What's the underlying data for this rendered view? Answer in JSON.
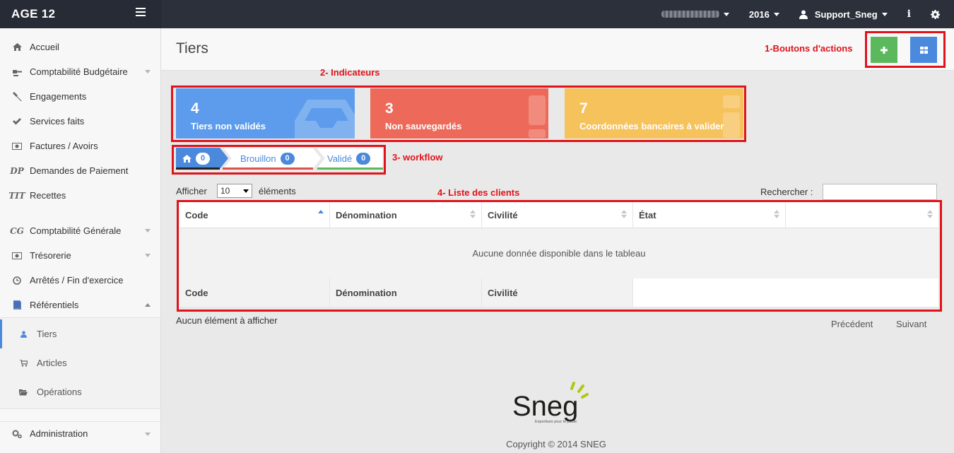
{
  "app": {
    "title": "AGE 12"
  },
  "topnav": {
    "year": "2016",
    "user": "Support_Sneg"
  },
  "sidebar": {
    "items": [
      {
        "label": "Accueil",
        "icon": "home-icon"
      },
      {
        "label": "Comptabilité Budgétaire",
        "icon": "gavel-icon",
        "has_submenu": true
      },
      {
        "label": "Engagements",
        "icon": "hammer-icon"
      },
      {
        "label": "Services faits",
        "icon": "check-icon"
      },
      {
        "label": "Factures / Avoirs",
        "icon": "money-icon"
      },
      {
        "label": "Demandes de Paiement",
        "icon": "dp-icon",
        "icon_text": "DP"
      },
      {
        "label": "Recettes",
        "icon": "tit-icon",
        "icon_text": "TIT"
      },
      {
        "label": "Comptabilité Générale",
        "icon": "cg-icon",
        "icon_text": "CG",
        "has_submenu": true
      },
      {
        "label": "Trésorerie",
        "icon": "money-icon",
        "has_submenu": true
      },
      {
        "label": "Arrêtés / Fin d'exercice",
        "icon": "clock-icon"
      },
      {
        "label": "Référentiels",
        "icon": "book-icon",
        "has_submenu": true,
        "expanded": true
      },
      {
        "label": "Administration",
        "icon": "cogs-icon",
        "has_submenu": true
      }
    ],
    "subitems": [
      {
        "label": "Tiers",
        "icon": "user-icon",
        "active": true
      },
      {
        "label": "Articles",
        "icon": "cart-icon"
      },
      {
        "label": "Opérations",
        "icon": "folder-open-icon"
      }
    ]
  },
  "page": {
    "title": "Tiers"
  },
  "annotations": {
    "actions": "1-Boutons d'actions",
    "indicators": "2- Indicateurs",
    "workflow": "3- workflow",
    "list": "4- Liste des clients"
  },
  "indicators": [
    {
      "value": "4",
      "caption": "Tiers non validés",
      "color": "#5d9cec"
    },
    {
      "value": "3",
      "caption": "Non sauvegardés",
      "color": "#ed6a5a"
    },
    {
      "value": "7",
      "caption": "Coordonnées bancaires à valider",
      "color": "#f6c25c"
    }
  ],
  "workflow": [
    {
      "label": "",
      "count": "0",
      "icon": "home-icon",
      "color": "#4a89dc"
    },
    {
      "label": "Brouillon",
      "count": "0",
      "color": "#d9534f"
    },
    {
      "label": "Validé",
      "count": "0",
      "color": "#5cb85c"
    }
  ],
  "datatable": {
    "show_prefix": "Afficher",
    "page_length": "10",
    "show_suffix": "éléments",
    "search_label": "Rechercher :",
    "columns": [
      "Code",
      "Dénomination",
      "Civilité",
      "État",
      ""
    ],
    "footer_columns": [
      "Code",
      "Dénomination",
      "Civilité"
    ],
    "empty_message": "Aucune donnée disponible dans le tableau",
    "info": "Aucun élément à afficher",
    "previous": "Précédent",
    "next": "Suivant"
  },
  "footer": {
    "logo_text": "Sneg",
    "logo_tagline": "Expertises pour le public",
    "copyright": "Copyright © 2014 SNEG"
  }
}
